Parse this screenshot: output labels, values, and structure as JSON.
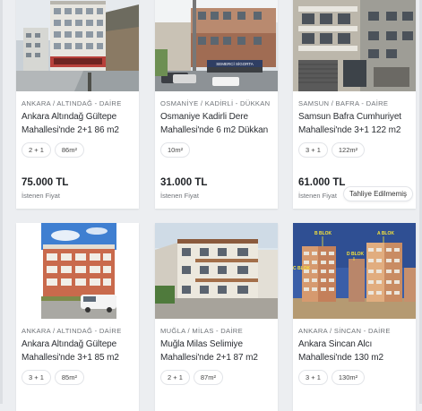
{
  "listings": [
    {
      "location": "ANKARA / ALTINDAĞ - DAİRE",
      "title": "Ankara Altındağ Gültepe Mahallesi'nde 2+1 86 m2",
      "chips": [
        "2 + 1",
        "86m²"
      ],
      "price": "75.000 TL",
      "price_label": "İstenen Fiyat"
    },
    {
      "location": "OSMANİYE / KADİRLİ - DÜKKAN",
      "title": "Osmaniye Kadirli Dere Mahallesi'nde 6 m2 Dükkan",
      "chips": [
        "10m²"
      ],
      "price": "31.000 TL",
      "price_label": "İstenen Fiyat",
      "sign_text": "SEMERCİ SİGORTA"
    },
    {
      "location": "SAMSUN / BAFRA - DAİRE",
      "title": "Samsun Bafra Cumhuriyet Mahallesi'nde 3+1 122 m2",
      "chips": [
        "3 + 1",
        "122m²"
      ],
      "price": "61.000 TL",
      "price_label": "İstenen Fiyat",
      "badge": "Tahliye Edilmemiş"
    },
    {
      "location": "ANKARA / ALTINDAĞ - DAİRE",
      "title": "Ankara Altındağ Gültepe Mahallesi'nde 3+1 85 m2",
      "chips": [
        "3 + 1",
        "85m²"
      ]
    },
    {
      "location": "MUĞLA / MİLAS - DAİRE",
      "title": "Muğla Milas Selimiye Mahallesi'nde 2+1 87 m2",
      "chips": [
        "2 + 1",
        "87m²"
      ]
    },
    {
      "location": "ANKARA / SİNCAN - DAİRE",
      "title": "Ankara Sincan Alcı Mahallesi'nde 130 m2",
      "chips": [
        "3 + 1",
        "130m²"
      ],
      "photo_labels": [
        "B BLOK",
        "A BLOK",
        "D BLOK",
        "C BLOK"
      ]
    }
  ]
}
